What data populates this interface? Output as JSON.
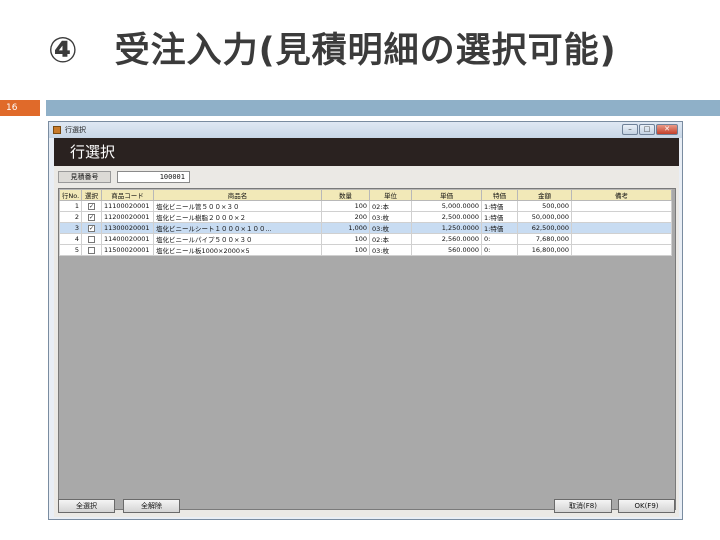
{
  "slide": {
    "title": "④　受注入力(見積明細の選択可能)",
    "page_number": "16"
  },
  "window": {
    "title": "行選択",
    "header": "行選択",
    "controls": {
      "minimize": "–",
      "maximize": "□",
      "close": "✕"
    }
  },
  "estimate": {
    "label": "見積番号",
    "value": "100001"
  },
  "grid": {
    "columns": [
      "行No.",
      "選択",
      "商品コード",
      "商品名",
      "数量",
      "単位",
      "単価",
      "特価",
      "金額",
      "備考"
    ],
    "rows": [
      {
        "no": "1",
        "selected": true,
        "code": "11100020001",
        "name": "塩化ビニール管５００×３０",
        "qty": "100",
        "unit": "02:本",
        "price": "5,000.0000",
        "special": "1:特価",
        "amount": "500,000",
        "note": ""
      },
      {
        "no": "2",
        "selected": true,
        "code": "11200020001",
        "name": "塩化ビニール樹脂２０００×２",
        "qty": "200",
        "unit": "03:枚",
        "price": "2,500.0000",
        "special": "1:特価",
        "amount": "50,000,000",
        "note": ""
      },
      {
        "no": "3",
        "selected": true,
        "code": "11300020001",
        "name": "塩化ビニールシート１０００×１００...",
        "qty": "1,000",
        "unit": "03:枚",
        "price": "1,250.0000",
        "special": "1:特価",
        "amount": "62,500,000",
        "note": ""
      },
      {
        "no": "4",
        "selected": false,
        "code": "11400020001",
        "name": "塩化ビニールパイプ５００×３０",
        "qty": "100",
        "unit": "02:本",
        "price": "2,560.0000",
        "special": "0:",
        "amount": "7,680,000",
        "note": ""
      },
      {
        "no": "5",
        "selected": false,
        "code": "11500020001",
        "name": "塩化ビニール板1000×2000×5",
        "qty": "100",
        "unit": "03:枚",
        "price": "560.0000",
        "special": "0:",
        "amount": "16,800,000",
        "note": ""
      }
    ],
    "selected_row": 3
  },
  "buttons": {
    "select_all": "全選択",
    "clear_all": "全解除",
    "cancel": "取消(F8)",
    "ok": "OK(F9)"
  },
  "colors": {
    "header_band": "#2a2220",
    "grid_header": "#f2e9b8",
    "selected_row": "#c8dcf2",
    "page_num_box": "#e06a2a",
    "page_bar": "#8fb0c8"
  }
}
